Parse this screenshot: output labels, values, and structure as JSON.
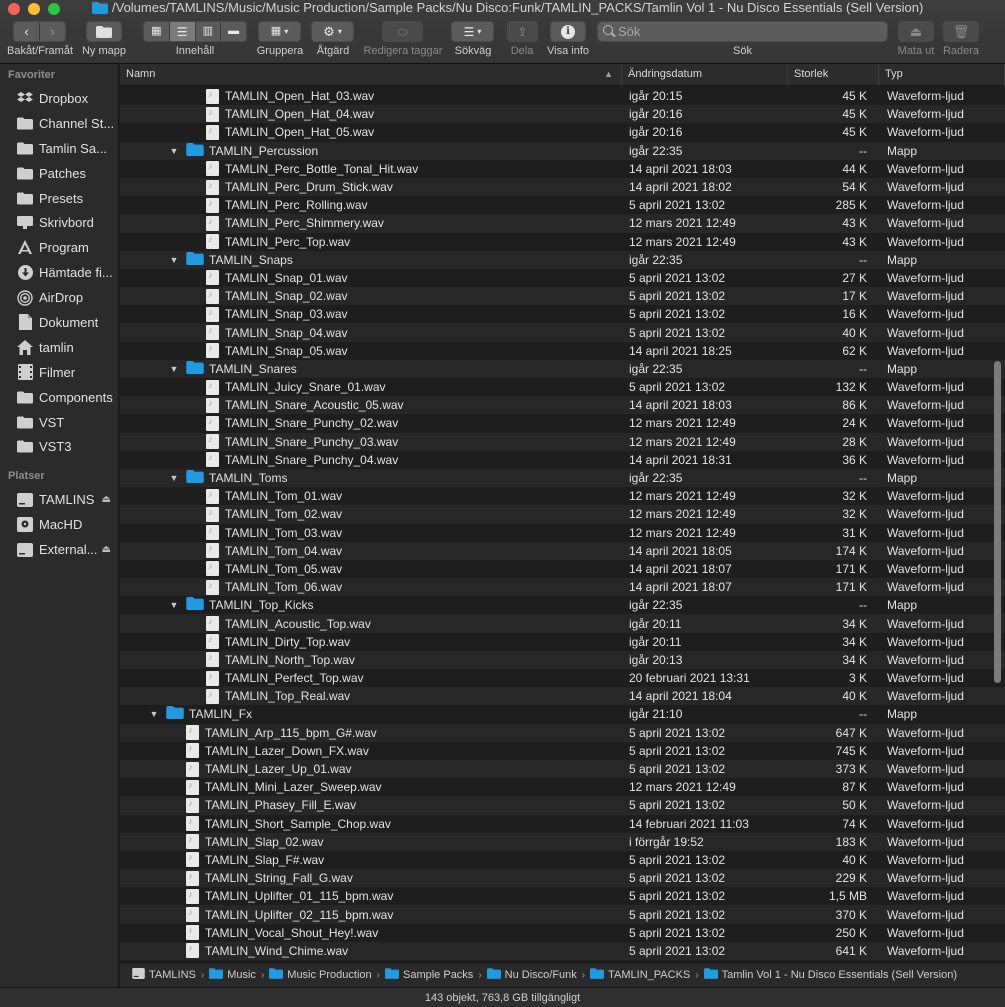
{
  "window": {
    "title": "/Volumes/TAMLINS/Music/Music Production/Sample Packs/Nu Disco:Funk/TAMLIN_PACKS/Tamlin Vol 1 - Nu Disco Essentials (Sell Version)"
  },
  "toolbar": {
    "back_forward_label": "Bakåt/Framåt",
    "new_folder_label": "Ny mapp",
    "content_label": "Innehåll",
    "group_label": "Gruppera",
    "action_label": "Åtgärd",
    "edit_tags_label": "Redigera taggar",
    "path_label": "Sökväg",
    "share_label": "Dela",
    "info_label": "Visa info",
    "search_label": "Sök",
    "search_placeholder": "Sök",
    "eject_label": "Mata ut",
    "delete_label": "Radera"
  },
  "sidebar": {
    "favorites_heading": "Favoriter",
    "favorites": [
      {
        "label": "Dropbox",
        "icon": "dropbox-icon"
      },
      {
        "label": "Channel St...",
        "icon": "folder-icon"
      },
      {
        "label": "Tamlin Sa...",
        "icon": "folder-icon"
      },
      {
        "label": "Patches",
        "icon": "folder-icon"
      },
      {
        "label": "Presets",
        "icon": "folder-icon"
      },
      {
        "label": "Skrivbord",
        "icon": "desktop-icon"
      },
      {
        "label": "Program",
        "icon": "applications-icon"
      },
      {
        "label": "Hämtade fi...",
        "icon": "downloads-icon"
      },
      {
        "label": "AirDrop",
        "icon": "airdrop-icon"
      },
      {
        "label": "Dokument",
        "icon": "document-icon"
      },
      {
        "label": "tamlin",
        "icon": "home-icon"
      },
      {
        "label": "Filmer",
        "icon": "movies-icon"
      },
      {
        "label": "Components",
        "icon": "folder-icon"
      },
      {
        "label": "VST",
        "icon": "folder-icon"
      },
      {
        "label": "VST3",
        "icon": "folder-icon"
      }
    ],
    "places_heading": "Platser",
    "places": [
      {
        "label": "TAMLINS",
        "icon": "drive-icon",
        "eject": "⏏"
      },
      {
        "label": "MacHD",
        "icon": "disk-icon",
        "eject": ""
      },
      {
        "label": "External...",
        "icon": "drive-icon",
        "eject": "⏏"
      }
    ]
  },
  "columns": {
    "name": "Namn",
    "date": "Ändringsdatum",
    "size": "Storlek",
    "type": "Typ"
  },
  "rows": [
    {
      "name": "TAMLIN_Open_Hat_03.wav",
      "date": "igår 20:15",
      "size": "45 K",
      "type": "Waveform-ljud",
      "level": 3,
      "kind": "file"
    },
    {
      "name": "TAMLIN_Open_Hat_04.wav",
      "date": "igår 20:16",
      "size": "45 K",
      "type": "Waveform-ljud",
      "level": 3,
      "kind": "file"
    },
    {
      "name": "TAMLIN_Open_Hat_05.wav",
      "date": "igår 20:16",
      "size": "45 K",
      "type": "Waveform-ljud",
      "level": 3,
      "kind": "file"
    },
    {
      "name": "TAMLIN_Percussion",
      "date": "igår 22:35",
      "size": "--",
      "type": "Mapp",
      "level": 2,
      "kind": "folder"
    },
    {
      "name": "TAMLIN_Perc_Bottle_Tonal_Hit.wav",
      "date": "14 april 2021 18:03",
      "size": "44 K",
      "type": "Waveform-ljud",
      "level": 3,
      "kind": "file"
    },
    {
      "name": "TAMLIN_Perc_Drum_Stick.wav",
      "date": "14 april 2021 18:02",
      "size": "54 K",
      "type": "Waveform-ljud",
      "level": 3,
      "kind": "file"
    },
    {
      "name": "TAMLIN_Perc_Rolling.wav",
      "date": "5 april 2021 13:02",
      "size": "285 K",
      "type": "Waveform-ljud",
      "level": 3,
      "kind": "file"
    },
    {
      "name": "TAMLIN_Perc_Shimmery.wav",
      "date": "12 mars 2021 12:49",
      "size": "43 K",
      "type": "Waveform-ljud",
      "level": 3,
      "kind": "file"
    },
    {
      "name": "TAMLIN_Perc_Top.wav",
      "date": "12 mars 2021 12:49",
      "size": "43 K",
      "type": "Waveform-ljud",
      "level": 3,
      "kind": "file"
    },
    {
      "name": "TAMLIN_Snaps",
      "date": "igår 22:35",
      "size": "--",
      "type": "Mapp",
      "level": 2,
      "kind": "folder"
    },
    {
      "name": "TAMLIN_Snap_01.wav",
      "date": "5 april 2021 13:02",
      "size": "27 K",
      "type": "Waveform-ljud",
      "level": 3,
      "kind": "file"
    },
    {
      "name": "TAMLIN_Snap_02.wav",
      "date": "5 april 2021 13:02",
      "size": "17 K",
      "type": "Waveform-ljud",
      "level": 3,
      "kind": "file"
    },
    {
      "name": "TAMLIN_Snap_03.wav",
      "date": "5 april 2021 13:02",
      "size": "16 K",
      "type": "Waveform-ljud",
      "level": 3,
      "kind": "file"
    },
    {
      "name": "TAMLIN_Snap_04.wav",
      "date": "5 april 2021 13:02",
      "size": "40 K",
      "type": "Waveform-ljud",
      "level": 3,
      "kind": "file"
    },
    {
      "name": "TAMLIN_Snap_05.wav",
      "date": "14 april 2021 18:25",
      "size": "62 K",
      "type": "Waveform-ljud",
      "level": 3,
      "kind": "file"
    },
    {
      "name": "TAMLIN_Snares",
      "date": "igår 22:35",
      "size": "--",
      "type": "Mapp",
      "level": 2,
      "kind": "folder"
    },
    {
      "name": "TAMLIN_Juicy_Snare_01.wav",
      "date": "5 april 2021 13:02",
      "size": "132 K",
      "type": "Waveform-ljud",
      "level": 3,
      "kind": "file"
    },
    {
      "name": "TAMLIN_Snare_Acoustic_05.wav",
      "date": "14 april 2021 18:03",
      "size": "86 K",
      "type": "Waveform-ljud",
      "level": 3,
      "kind": "file"
    },
    {
      "name": "TAMLIN_Snare_Punchy_02.wav",
      "date": "12 mars 2021 12:49",
      "size": "24 K",
      "type": "Waveform-ljud",
      "level": 3,
      "kind": "file"
    },
    {
      "name": "TAMLIN_Snare_Punchy_03.wav",
      "date": "12 mars 2021 12:49",
      "size": "28 K",
      "type": "Waveform-ljud",
      "level": 3,
      "kind": "file"
    },
    {
      "name": "TAMLIN_Snare_Punchy_04.wav",
      "date": "14 april 2021 18:31",
      "size": "36 K",
      "type": "Waveform-ljud",
      "level": 3,
      "kind": "file"
    },
    {
      "name": "TAMLIN_Toms",
      "date": "igår 22:35",
      "size": "--",
      "type": "Mapp",
      "level": 2,
      "kind": "folder"
    },
    {
      "name": "TAMLIN_Tom_01.wav",
      "date": "12 mars 2021 12:49",
      "size": "32 K",
      "type": "Waveform-ljud",
      "level": 3,
      "kind": "file"
    },
    {
      "name": "TAMLIN_Tom_02.wav",
      "date": "12 mars 2021 12:49",
      "size": "32 K",
      "type": "Waveform-ljud",
      "level": 3,
      "kind": "file"
    },
    {
      "name": "TAMLIN_Tom_03.wav",
      "date": "12 mars 2021 12:49",
      "size": "31 K",
      "type": "Waveform-ljud",
      "level": 3,
      "kind": "file"
    },
    {
      "name": "TAMLIN_Tom_04.wav",
      "date": "14 april 2021 18:05",
      "size": "174 K",
      "type": "Waveform-ljud",
      "level": 3,
      "kind": "file"
    },
    {
      "name": "TAMLIN_Tom_05.wav",
      "date": "14 april 2021 18:07",
      "size": "171 K",
      "type": "Waveform-ljud",
      "level": 3,
      "kind": "file"
    },
    {
      "name": "TAMLIN_Tom_06.wav",
      "date": "14 april 2021 18:07",
      "size": "171 K",
      "type": "Waveform-ljud",
      "level": 3,
      "kind": "file"
    },
    {
      "name": "TAMLIN_Top_Kicks",
      "date": "igår 22:35",
      "size": "--",
      "type": "Mapp",
      "level": 2,
      "kind": "folder"
    },
    {
      "name": "TAMLIN_Acoustic_Top.wav",
      "date": "igår 20:11",
      "size": "34 K",
      "type": "Waveform-ljud",
      "level": 3,
      "kind": "file"
    },
    {
      "name": "TAMLIN_Dirty_Top.wav",
      "date": "igår 20:11",
      "size": "34 K",
      "type": "Waveform-ljud",
      "level": 3,
      "kind": "file"
    },
    {
      "name": "TAMLIN_North_Top.wav",
      "date": "igår 20:13",
      "size": "34 K",
      "type": "Waveform-ljud",
      "level": 3,
      "kind": "file"
    },
    {
      "name": "TAMLIN_Perfect_Top.wav",
      "date": "20 februari 2021 13:31",
      "size": "3 K",
      "type": "Waveform-ljud",
      "level": 3,
      "kind": "file"
    },
    {
      "name": "TAMLIN_Top_Real.wav",
      "date": "14 april 2021 18:04",
      "size": "40 K",
      "type": "Waveform-ljud",
      "level": 3,
      "kind": "file"
    },
    {
      "name": "TAMLIN_Fx",
      "date": "igår 21:10",
      "size": "--",
      "type": "Mapp",
      "level": 1,
      "kind": "folder"
    },
    {
      "name": "TAMLIN_Arp_115_bpm_G#.wav",
      "date": "5 april 2021 13:02",
      "size": "647 K",
      "type": "Waveform-ljud",
      "level": 2,
      "kind": "file"
    },
    {
      "name": "TAMLIN_Lazer_Down_FX.wav",
      "date": "5 april 2021 13:02",
      "size": "745 K",
      "type": "Waveform-ljud",
      "level": 2,
      "kind": "file"
    },
    {
      "name": "TAMLIN_Lazer_Up_01.wav",
      "date": "5 april 2021 13:02",
      "size": "373 K",
      "type": "Waveform-ljud",
      "level": 2,
      "kind": "file"
    },
    {
      "name": "TAMLIN_Mini_Lazer_Sweep.wav",
      "date": "12 mars 2021 12:49",
      "size": "87 K",
      "type": "Waveform-ljud",
      "level": 2,
      "kind": "file"
    },
    {
      "name": "TAMLIN_Phasey_Fill_E.wav",
      "date": "5 april 2021 13:02",
      "size": "50 K",
      "type": "Waveform-ljud",
      "level": 2,
      "kind": "file"
    },
    {
      "name": "TAMLIN_Short_Sample_Chop.wav",
      "date": "14 februari 2021 11:03",
      "size": "74 K",
      "type": "Waveform-ljud",
      "level": 2,
      "kind": "file"
    },
    {
      "name": "TAMLIN_Slap_02.wav",
      "date": "i förrgår 19:52",
      "size": "183 K",
      "type": "Waveform-ljud",
      "level": 2,
      "kind": "file"
    },
    {
      "name": "TAMLIN_Slap_F#.wav",
      "date": "5 april 2021 13:02",
      "size": "40 K",
      "type": "Waveform-ljud",
      "level": 2,
      "kind": "file"
    },
    {
      "name": "TAMLIN_String_Fall_G.wav",
      "date": "5 april 2021 13:02",
      "size": "229 K",
      "type": "Waveform-ljud",
      "level": 2,
      "kind": "file"
    },
    {
      "name": "TAMLIN_Uplifter_01_115_bpm.wav",
      "date": "5 april 2021 13:02",
      "size": "1,5 MB",
      "type": "Waveform-ljud",
      "level": 2,
      "kind": "file"
    },
    {
      "name": "TAMLIN_Uplifter_02_115_bpm.wav",
      "date": "5 april 2021 13:02",
      "size": "370 K",
      "type": "Waveform-ljud",
      "level": 2,
      "kind": "file"
    },
    {
      "name": "TAMLIN_Vocal_Shout_Hey!.wav",
      "date": "5 april 2021 13:02",
      "size": "250 K",
      "type": "Waveform-ljud",
      "level": 2,
      "kind": "file"
    },
    {
      "name": "TAMLIN_Wind_Chime.wav",
      "date": "5 april 2021 13:02",
      "size": "641 K",
      "type": "Waveform-ljud",
      "level": 2,
      "kind": "file"
    }
  ],
  "pathbar": [
    {
      "label": "TAMLINS",
      "icon": "drive-icon"
    },
    {
      "label": "Music",
      "icon": "folder-icon"
    },
    {
      "label": "Music Production",
      "icon": "folder-icon"
    },
    {
      "label": "Sample Packs",
      "icon": "folder-icon"
    },
    {
      "label": "Nu Disco/Funk",
      "icon": "folder-icon"
    },
    {
      "label": "TAMLIN_PACKS",
      "icon": "folder-icon"
    },
    {
      "label": "Tamlin Vol 1 - Nu Disco Essentials (Sell Version)",
      "icon": "folder-icon"
    }
  ],
  "status": "143 objekt, 763,8 GB tillgängligt",
  "colors": {
    "folder_blue": "#1e9be0",
    "background": "#1e1e1e",
    "row_alt": "#272727"
  }
}
